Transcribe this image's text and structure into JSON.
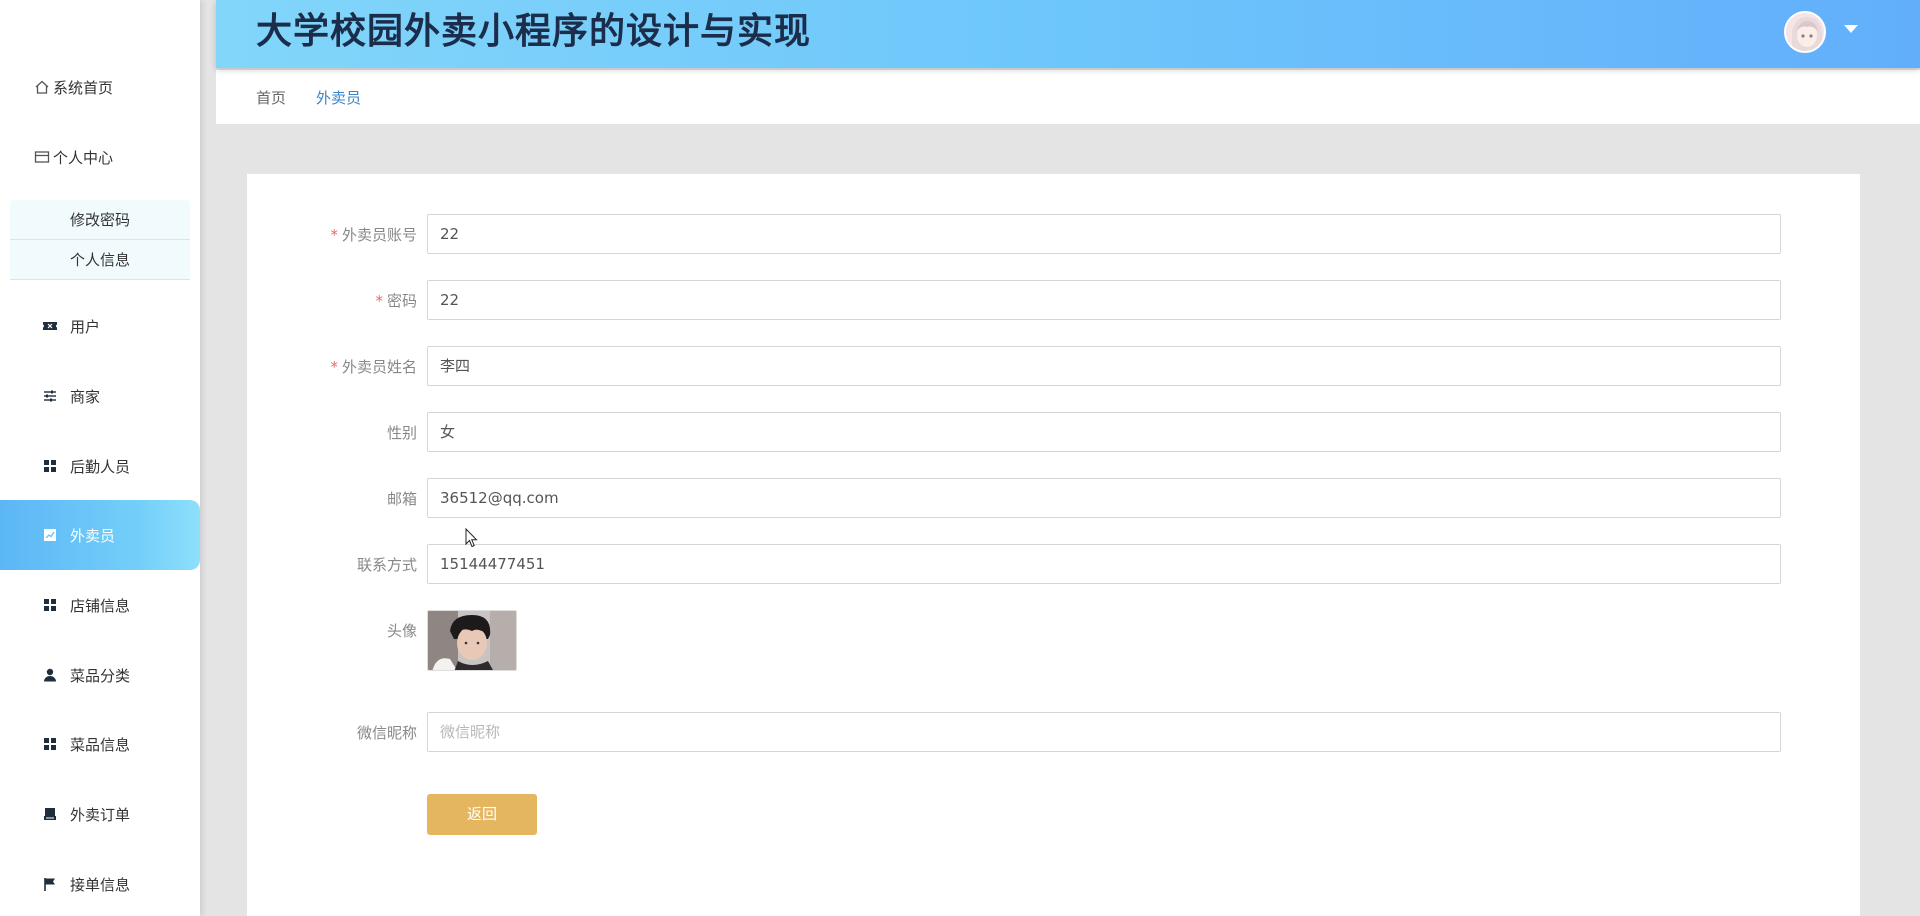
{
  "app": {
    "title": "大学校园外卖小程序的设计与实现"
  },
  "sidebar": {
    "home": "系统首页",
    "personal": "个人中心",
    "sub_items": [
      "修改密码",
      "个人信息"
    ],
    "items": [
      {
        "label": "用户",
        "icon": "ticket-icon"
      },
      {
        "label": "商家",
        "icon": "sliders-icon"
      },
      {
        "label": "后勤人员",
        "icon": "grid-icon"
      },
      {
        "label": "外卖员",
        "icon": "chart-icon",
        "active": true
      },
      {
        "label": "店铺信息",
        "icon": "grid-icon"
      },
      {
        "label": "菜品分类",
        "icon": "user-icon"
      },
      {
        "label": "菜品信息",
        "icon": "grid-icon"
      },
      {
        "label": "外卖订单",
        "icon": "printer-icon"
      },
      {
        "label": "接单信息",
        "icon": "flag-icon"
      }
    ]
  },
  "breadcrumb": {
    "home": "首页",
    "current": "外卖员"
  },
  "form": {
    "account": {
      "label": "外卖员账号",
      "required": true,
      "value": "22"
    },
    "password": {
      "label": "密码",
      "required": true,
      "value": "22"
    },
    "name": {
      "label": "外卖员姓名",
      "required": true,
      "value": "李四"
    },
    "gender": {
      "label": "性别",
      "value": "女"
    },
    "email": {
      "label": "邮箱",
      "value": "36512@qq.com"
    },
    "phone": {
      "label": "联系方式",
      "value": "15144477451"
    },
    "avatar": {
      "label": "头像"
    },
    "wechat": {
      "label": "微信昵称",
      "value": "",
      "placeholder": "微信昵称"
    },
    "back_button": "返回"
  },
  "colors": {
    "accent": "#5cb6f6",
    "button": "#e5b660",
    "required": "#e56b6b"
  }
}
